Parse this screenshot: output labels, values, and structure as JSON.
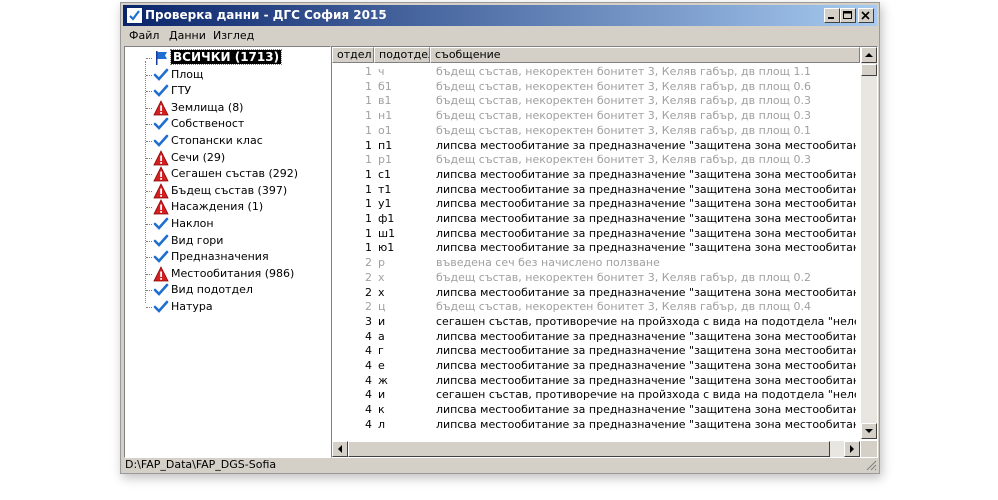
{
  "window": {
    "title": "Проверка данни - ДГС София 2015"
  },
  "menu": {
    "items": [
      "Файл",
      "Данни",
      "Изглед"
    ]
  },
  "tree": {
    "items": [
      {
        "label": "ВСИЧКИ (1713)",
        "icon": "flag-icon",
        "selected": true
      },
      {
        "label": "Площ",
        "icon": "check-icon"
      },
      {
        "label": "ГТУ",
        "icon": "check-icon"
      },
      {
        "label": "Землища (8)",
        "icon": "warning-icon"
      },
      {
        "label": "Собственост",
        "icon": "check-icon"
      },
      {
        "label": "Стопански клас",
        "icon": "check-icon"
      },
      {
        "label": "Сечи (29)",
        "icon": "warning-icon"
      },
      {
        "label": "Сегашен състав (292)",
        "icon": "warning-icon"
      },
      {
        "label": "Бъдещ състав (397)",
        "icon": "warning-icon"
      },
      {
        "label": "Насаждения (1)",
        "icon": "warning-icon"
      },
      {
        "label": "Наклон",
        "icon": "check-icon"
      },
      {
        "label": "Вид гори",
        "icon": "check-icon"
      },
      {
        "label": "Предназначения",
        "icon": "check-icon"
      },
      {
        "label": "Местообитания (986)",
        "icon": "warning-icon"
      },
      {
        "label": "Вид подотдел",
        "icon": "check-icon"
      },
      {
        "label": "Натура",
        "icon": "check-icon"
      }
    ]
  },
  "list": {
    "columns": [
      "отдел",
      "подотдел",
      "съобщение"
    ],
    "rows": [
      {
        "otdel": "1",
        "podotdel": "ч",
        "message": "бъдещ състав, некоректен бонитет 3, Келяв габър, дв площ 1.1",
        "gray": true
      },
      {
        "otdel": "1",
        "podotdel": "б1",
        "message": "бъдещ състав, некоректен бонитет 3, Келяв габър, дв площ 0.6",
        "gray": true
      },
      {
        "otdel": "1",
        "podotdel": "в1",
        "message": "бъдещ състав, некоректен бонитет 3, Келяв габър, дв площ 0.3",
        "gray": true
      },
      {
        "otdel": "1",
        "podotdel": "н1",
        "message": "бъдещ състав, некоректен бонитет 3, Келяв габър, дв площ 0.3",
        "gray": true
      },
      {
        "otdel": "1",
        "podotdel": "о1",
        "message": "бъдещ състав, некоректен бонитет 3, Келяв габър, дв площ 0.1",
        "gray": true
      },
      {
        "otdel": "1",
        "podotdel": "п1",
        "message": "липсва местообитание за предназначение \"защитена зона местообитания\"",
        "gray": false
      },
      {
        "otdel": "1",
        "podotdel": "р1",
        "message": "бъдещ състав, некоректен бонитет 3, Келяв габър, дв площ 0.3",
        "gray": true
      },
      {
        "otdel": "1",
        "podotdel": "с1",
        "message": "липсва местообитание за предназначение \"защитена зона местообитания\"",
        "gray": false
      },
      {
        "otdel": "1",
        "podotdel": "т1",
        "message": "липсва местообитание за предназначение \"защитена зона местообитания\"",
        "gray": false
      },
      {
        "otdel": "1",
        "podotdel": "у1",
        "message": "липсва местообитание за предназначение \"защитена зона местообитания\"",
        "gray": false
      },
      {
        "otdel": "1",
        "podotdel": "ф1",
        "message": "липсва местообитание за предназначение \"защитена зона местообитания\"",
        "gray": false
      },
      {
        "otdel": "1",
        "podotdel": "ш1",
        "message": "липсва местообитание за предназначение \"защитена зона местообитания\"",
        "gray": false
      },
      {
        "otdel": "1",
        "podotdel": "ю1",
        "message": "липсва местообитание за предназначение \"защитена зона местообитания\"",
        "gray": false
      },
      {
        "otdel": "2",
        "podotdel": "р",
        "message": "въведена сеч без начислено ползване",
        "gray": true
      },
      {
        "otdel": "2",
        "podotdel": "х",
        "message": "бъдещ състав, некоректен бонитет 3, Келяв габър, дв площ 0.2",
        "gray": true
      },
      {
        "otdel": "2",
        "podotdel": "х",
        "message": "липсва местообитание за предназначение \"защитена зона местообитания\"",
        "gray": false
      },
      {
        "otdel": "2",
        "podotdel": "ц",
        "message": "бъдещ състав, некоректен бонитет 3, Келяв габър, дв площ 0.4",
        "gray": true
      },
      {
        "otdel": "3",
        "podotdel": "и",
        "message": "сегашен състав, противоречие на пройзхода с вида на подотдела \"нелесопригодна",
        "gray": false
      },
      {
        "otdel": "4",
        "podotdel": "а",
        "message": "липсва местообитание за предназначение \"защитена зона местообитания\"",
        "gray": false
      },
      {
        "otdel": "4",
        "podotdel": "г",
        "message": "липсва местообитание за предназначение \"защитена зона местообитания\"",
        "gray": false
      },
      {
        "otdel": "4",
        "podotdel": "е",
        "message": "липсва местообитание за предназначение \"защитена зона местообитания\"",
        "gray": false
      },
      {
        "otdel": "4",
        "podotdel": "ж",
        "message": "липсва местообитание за предназначение \"защитена зона местообитания\"",
        "gray": false
      },
      {
        "otdel": "4",
        "podotdel": "и",
        "message": "сегашен състав, противоречие на пройзхода с вида на подотдела \"нелесопригодна",
        "gray": false
      },
      {
        "otdel": "4",
        "podotdel": "к",
        "message": "липсва местообитание за предназначение \"защитена зона местообитания\"",
        "gray": false
      },
      {
        "otdel": "4",
        "podotdel": "л",
        "message": "липсва местообитание за предназначение \"защитена зона местообитания\"",
        "gray": false
      }
    ]
  },
  "statusbar": {
    "path": "D:\\FAP_Data\\FAP_DGS-Sofia"
  },
  "colors": {
    "titlebar_start": "#0a246a",
    "titlebar_end": "#a6caf0",
    "check": "#1f6fd1",
    "warning": "#d42020",
    "gray_text": "#a0a0a0"
  }
}
